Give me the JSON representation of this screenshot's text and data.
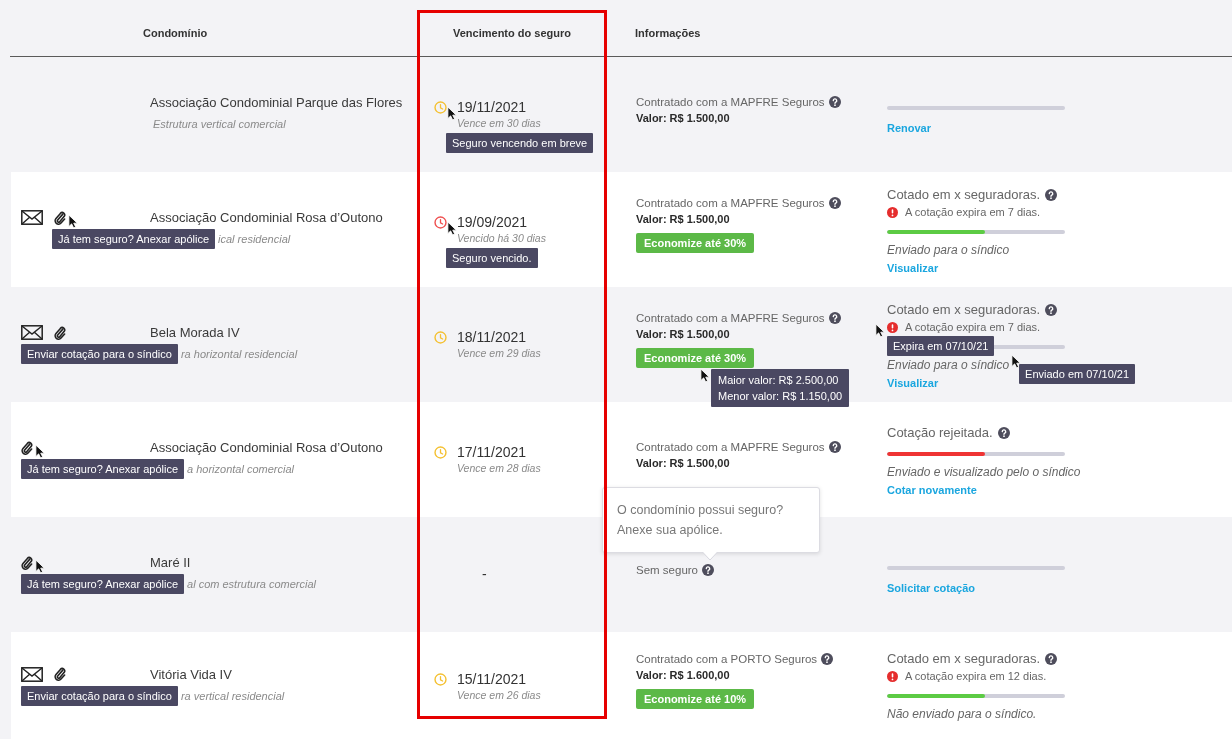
{
  "table": {
    "columns": [
      "Condomínio",
      "Vencimento do seguro",
      "Informações"
    ],
    "rows": [
      {
        "name": "Associação Condominial Parque das Flores",
        "type": "Estrutura vertical comercial",
        "expiry": {
          "expired": false,
          "date": "19/11/2021",
          "note": "Vence em 30 dias",
          "tooltip": {
            "text": "Seguro vencendo em breve",
            "cursor": true
          }
        },
        "info": {
          "insurer": "Contratado com a MAPFRE Seguros",
          "value": "Valor: R$ 1.500,00"
        },
        "quote": {
          "link": "Renovar"
        }
      },
      {
        "actions": [
          {
            "kind": "mail"
          },
          {
            "kind": "attach",
            "tooltip": {
              "text": "Já tem seguro? Anexar apólice",
              "cursor": true
            }
          }
        ],
        "name": "Associação Condominial Rosa d’Outono",
        "type": "ical residencial",
        "expiry": {
          "expired": true,
          "date": "19/09/2021",
          "note": "Vencido há 30 dias",
          "tooltip": {
            "text": "Seguro vencido.",
            "cursor": true
          }
        },
        "info": {
          "insurer": "Contratado com a MAPFRE Seguros",
          "value": "Valor: R$ 1.500,00",
          "savings": "Economize até 30%"
        },
        "quote": {
          "title": "Cotado em x seguradoras.",
          "warning": "A cotação expira em 7 dias.",
          "level": 0.55,
          "color": "#5ccb44",
          "note": "Enviado para o síndico",
          "link": "Visualizar"
        }
      },
      {
        "actions": [
          {
            "kind": "mail",
            "tooltip": {
              "text": "Enviar cotação para o síndico"
            }
          },
          {
            "kind": "attach"
          }
        ],
        "name": "Bela Morada IV",
        "type": "ra horizontal residencial",
        "expiry": {
          "expired": false,
          "date": "18/11/2021",
          "note": "Vence em 29 dias"
        },
        "info": {
          "insurer": "Contratado com a MAPFRE Seguros",
          "value": "Valor: R$ 1.500,00",
          "savings": "Economize até 30%",
          "savings_tooltip": {
            "lines": [
              "Maior valor: R$ 2.500,00",
              "Menor valor: R$ 1.150,00"
            ],
            "cursor": true
          }
        },
        "quote": {
          "title": "Cotado em x seguradoras.",
          "warning": "A cotação expira em 7 dias.",
          "warning_tooltip": {
            "text": "Expira em 07/10/21",
            "cursor": true
          },
          "note": "Enviado para o síndico",
          "note_tooltip": {
            "text": "Enviado em 07/10/21",
            "cursor": true
          },
          "link": "Visualizar"
        }
      },
      {
        "actions": [
          {
            "kind": "attach",
            "tooltip": {
              "text": "Já tem seguro? Anexar apólice",
              "cursor": true
            }
          }
        ],
        "name": "Associação Condominial Rosa d’Outono",
        "type": "a horizontal comercial",
        "expiry": {
          "expired": false,
          "date": "17/11/2021",
          "note": "Vence em 28 dias"
        },
        "info": {
          "insurer": "Contratado com a MAPFRE Seguros",
          "value": "Valor: R$ 1.500,00"
        },
        "quote": {
          "title": "Cotação rejeitada.",
          "level": 0.55,
          "color": "#ef3434",
          "note": "Enviado e visualizado pelo o síndico",
          "link": "Cotar novamente"
        }
      },
      {
        "actions": [
          {
            "kind": "attach",
            "tooltip": {
              "text": "Já tem seguro? Anexar apólice",
              "cursor": true
            }
          }
        ],
        "name": "Maré II",
        "type": "al com estrutura comercial",
        "expiry": {
          "date": "-"
        },
        "info": {
          "insurer": "Sem seguro",
          "popover": "O condomínio possui seguro? Anexe sua apólice."
        },
        "quote": {
          "link": "Solicitar cotação"
        }
      },
      {
        "actions": [
          {
            "kind": "mail",
            "tooltip": {
              "text": "Enviar cotação para o síndico"
            }
          },
          {
            "kind": "attach"
          }
        ],
        "name": "Vitória Vida IV",
        "type": "ra vertical residencial",
        "expiry": {
          "expired": false,
          "date": "15/11/2021",
          "note": "Vence em 26 dias"
        },
        "info": {
          "insurer": "Contratado com a PORTO Seguros",
          "value": "Valor: R$ 1.600,00",
          "savings": "Economize até 10%"
        },
        "quote": {
          "title": "Cotado em x seguradoras.",
          "warning": "A cotação expira em 12 dias.",
          "level": 0.55,
          "color": "#5ccb44",
          "note": "Não enviado para o síndico."
        }
      }
    ]
  }
}
